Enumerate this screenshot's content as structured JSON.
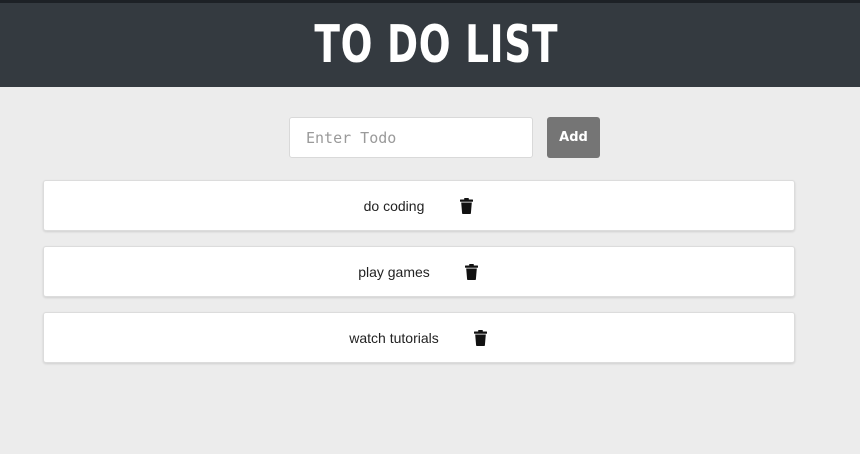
{
  "header": {
    "title": "TO DO LIST"
  },
  "form": {
    "input_placeholder": "Enter Todo",
    "input_value": "",
    "add_label": "Add"
  },
  "todos": [
    {
      "text": "do coding",
      "action_icon": "trash-icon"
    },
    {
      "text": "play games",
      "action_icon": "trash-icon"
    },
    {
      "text": "watch tutorials",
      "action_icon": "trash-icon"
    }
  ],
  "colors": {
    "header_bg": "#343a40",
    "page_bg": "#ececec",
    "add_button_bg": "#757575"
  }
}
